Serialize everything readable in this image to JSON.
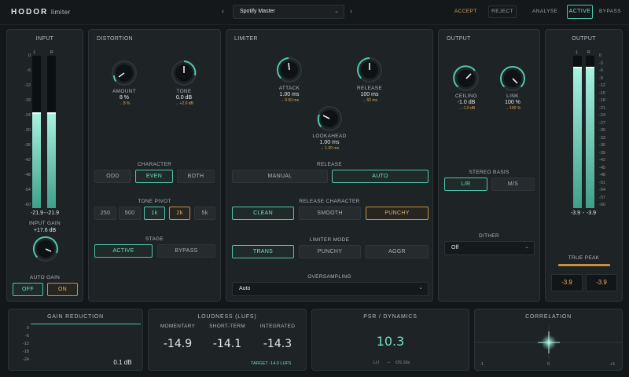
{
  "header": {
    "brand": "HODOR",
    "product": "limiter",
    "preset": "Spotify Master",
    "prev": "‹",
    "next": "›",
    "accept": "ACCEPT",
    "reject": "REJECT",
    "analyse": "ANALYSE",
    "active": "ACTIVE",
    "bypass": "BYPASS"
  },
  "input": {
    "title": "INPUT",
    "ch_l": "L",
    "ch_r": "R",
    "scale": [
      "0",
      "-6",
      "-12",
      "-18",
      "-24",
      "-30",
      "-36",
      "-42",
      "-48",
      "-54",
      "-60"
    ],
    "readout_l": "-21.9",
    "readout_r": "-21.9",
    "gain_label": "INPUT GAIN",
    "gain_value": "+17.6 dB",
    "auto_gain": "AUTO GAIN",
    "off": "OFF",
    "on": "ON",
    "level_l": 0.63,
    "level_r": 0.63
  },
  "distortion": {
    "title": "DISTORTION",
    "amount_label": "AMOUNT",
    "amount_value": "8 %",
    "amount_sub": "→ 8 %",
    "tone_label": "TONE",
    "tone_value": "0.0 dB",
    "tone_sub": "→ +2.0 dB",
    "character_label": "CHARACTER",
    "character": [
      "ODD",
      "EVEN",
      "BOTH"
    ],
    "pivot_label": "TONE PIVOT",
    "pivot": [
      "250",
      "500",
      "1k",
      "2k",
      "5k"
    ],
    "stage_label": "STAGE",
    "stage": [
      "ACTIVE",
      "BYPASS"
    ]
  },
  "limiter": {
    "title": "LIMITER",
    "attack_label": "ATTACK",
    "attack_value": "1.00 ms",
    "attack_sub": "→ 0.50 ms",
    "release_label": "RELEASE",
    "release_value": "100 ms",
    "release_sub": "→ 60 ms",
    "lookahead_label": "LOOKAHEAD",
    "lookahead_value": "1.00 ms",
    "lookahead_sub": "→ 1.00 ms",
    "release_mode_label": "RELEASE",
    "release_mode": [
      "MANUAL",
      "AUTO"
    ],
    "rel_char_label": "RELEASE CHARACTER",
    "rel_char": [
      "CLEAN",
      "SMOOTH",
      "PUNCHY"
    ],
    "mode_label": "LIMITER MODE",
    "mode": [
      "TRANS",
      "PUNCHY",
      "AGGR"
    ],
    "os_label": "OVERSAMPLING",
    "os_value": "Auto"
  },
  "output": {
    "title": "OUTPUT",
    "ceiling_label": "CEILING",
    "ceiling_value": "-1.0 dB",
    "ceiling_sub": "→ -1.0 dB",
    "link_label": "LINK",
    "link_value": "100 %",
    "link_sub": "→ 100 %",
    "stereo_label": "STEREO BASIS",
    "stereo": [
      "L/R",
      "M/S"
    ],
    "dither_label": "DITHER",
    "dither_value": "Off"
  },
  "out_meter": {
    "title": "OUTPUT",
    "ch_l": "L",
    "ch_r": "R",
    "scale": [
      "0",
      "-3",
      "-6",
      "-9",
      "-12",
      "-15",
      "-18",
      "-21",
      "-24",
      "-27",
      "-30",
      "-33",
      "-36",
      "-39",
      "-42",
      "-45",
      "-48",
      "-51",
      "-54",
      "-57",
      "-60"
    ],
    "readout_l": "-3.9",
    "readout_r": "-3.9",
    "true_peak": "TRUE PEAK",
    "tp_l": "-3.9",
    "tp_r": "-3.9",
    "level_l": 0.93,
    "level_r": 0.93
  },
  "gain_reduction": {
    "title": "GAIN REDUCTION",
    "scale": [
      "0",
      "-6",
      "-12",
      "-18",
      "-24"
    ],
    "value": "0.1 dB"
  },
  "loudness": {
    "title": "LOUDNESS (LUFS)",
    "momentary_label": "MOMENTARY",
    "momentary": "-14.9",
    "short_label": "SHORT-TERM",
    "short": "-14.1",
    "integrated_label": "INTEGRATED",
    "integrated": "-14.3",
    "target": "TARGET -14.0 LUFS"
  },
  "psr": {
    "title": "PSR / DYNAMICS",
    "value": "10.3",
    "lu": "LU",
    "dash": "–",
    "os": "OS 16x"
  },
  "correlation": {
    "title": "CORRELATION",
    "left": "-1",
    "mid": "0",
    "right": "+1"
  },
  "colors": {
    "accent": "#4fc6ac",
    "amber": "#d9a55a",
    "bg": "#141719",
    "panel": "#1e2326"
  }
}
